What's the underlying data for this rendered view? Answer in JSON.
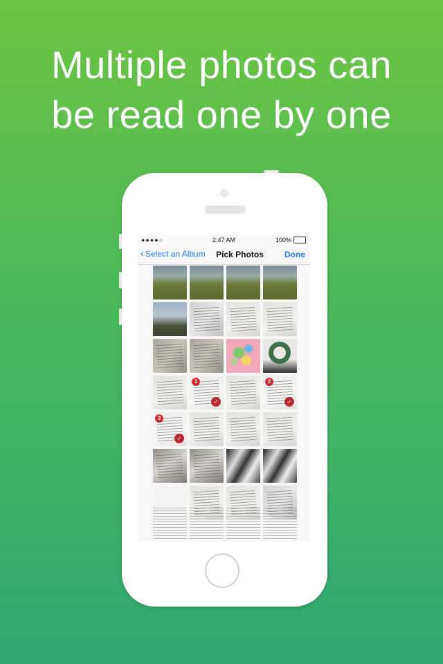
{
  "headline": {
    "line1": "Multiple photos can",
    "line2": "be read one by one"
  },
  "statusbar": {
    "carrier": "●●●●○",
    "time": "2:47 AM",
    "battery": "100%"
  },
  "navbar": {
    "back_label": "Select an Album",
    "title": "Pick Photos",
    "done_label": "Done"
  },
  "grid": {
    "rows": [
      [
        {
          "kind": "grass"
        },
        {
          "kind": "grass"
        },
        {
          "kind": "grass"
        },
        {
          "kind": "grass"
        }
      ],
      [
        {
          "kind": "sky"
        },
        {
          "kind": "paper"
        },
        {
          "kind": "paper2"
        },
        {
          "kind": "paper2"
        }
      ],
      [
        {
          "kind": "paper3"
        },
        {
          "kind": "paper3"
        },
        {
          "kind": "pink"
        },
        {
          "kind": "wreath"
        }
      ],
      [
        {
          "kind": "paper2"
        },
        {
          "kind": "paper2",
          "selected_index": "1"
        },
        {
          "kind": "paper2"
        },
        {
          "kind": "paper2",
          "selected_index": "2"
        }
      ],
      [
        {
          "kind": "paper2",
          "selected_index": "3"
        },
        {
          "kind": "paper2"
        },
        {
          "kind": "paper2"
        },
        {
          "kind": "paper2"
        }
      ],
      [
        {
          "kind": "dark"
        },
        {
          "kind": "dark"
        },
        {
          "kind": "bw"
        },
        {
          "kind": "bw"
        }
      ],
      [
        {
          "kind": "white"
        },
        {
          "kind": "paper2"
        },
        {
          "kind": "paper2"
        },
        {
          "kind": "paper"
        }
      ]
    ]
  },
  "colors": {
    "accent": "#1f7cf2",
    "badge": "#d9262d",
    "check": "#c4262e"
  }
}
